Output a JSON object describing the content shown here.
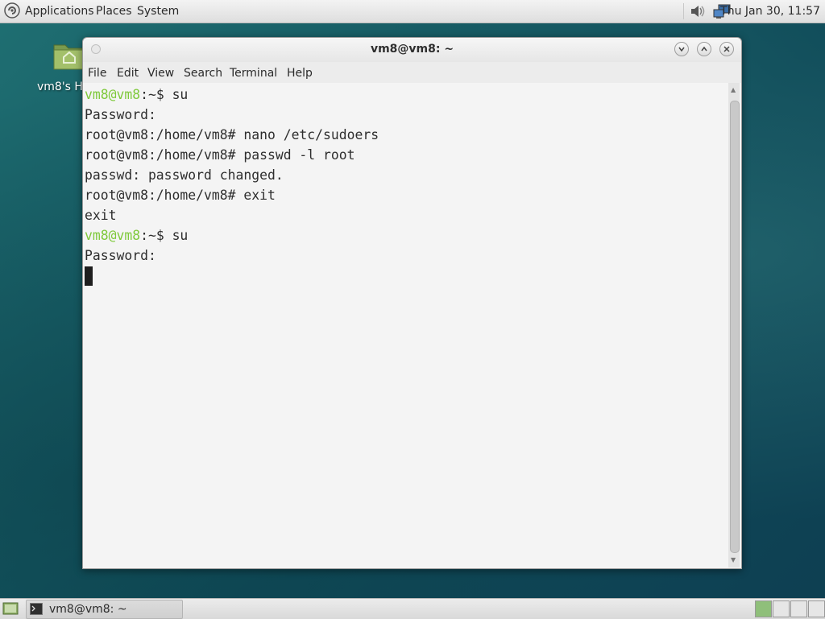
{
  "top_panel": {
    "menus": [
      "Applications",
      "Places",
      "System"
    ],
    "tray_icons": [
      "volume-icon",
      "network-icon"
    ],
    "clock": "Thu Jan 30, 11:57"
  },
  "desktop": {
    "home_icon_label": "vm8's H"
  },
  "window": {
    "title": "vm8@vm8: ~",
    "menu": [
      "File",
      "Edit",
      "View",
      "Search",
      "Terminal",
      "Help"
    ]
  },
  "terminal": {
    "lines": [
      {
        "user": "vm8@vm8",
        "path": ":~",
        "rest": "$ su"
      },
      {
        "text": "Password:"
      },
      {
        "text": "root@vm8:/home/vm8# nano /etc/sudoers"
      },
      {
        "text": "root@vm8:/home/vm8# passwd -l root"
      },
      {
        "text": "passwd: password changed."
      },
      {
        "text": "root@vm8:/home/vm8# exit"
      },
      {
        "text": "exit"
      },
      {
        "user": "vm8@vm8",
        "path": ":~",
        "rest": "$ su"
      },
      {
        "text": "Password:"
      }
    ]
  },
  "bottom_panel": {
    "task_label": "vm8@vm8: ~",
    "workspaces": 4,
    "active_workspace": 1
  },
  "colors": {
    "prompt_user": "#7ec93a",
    "terminal_bg": "#f4f4f4",
    "desktop_teal": "#165a63"
  }
}
